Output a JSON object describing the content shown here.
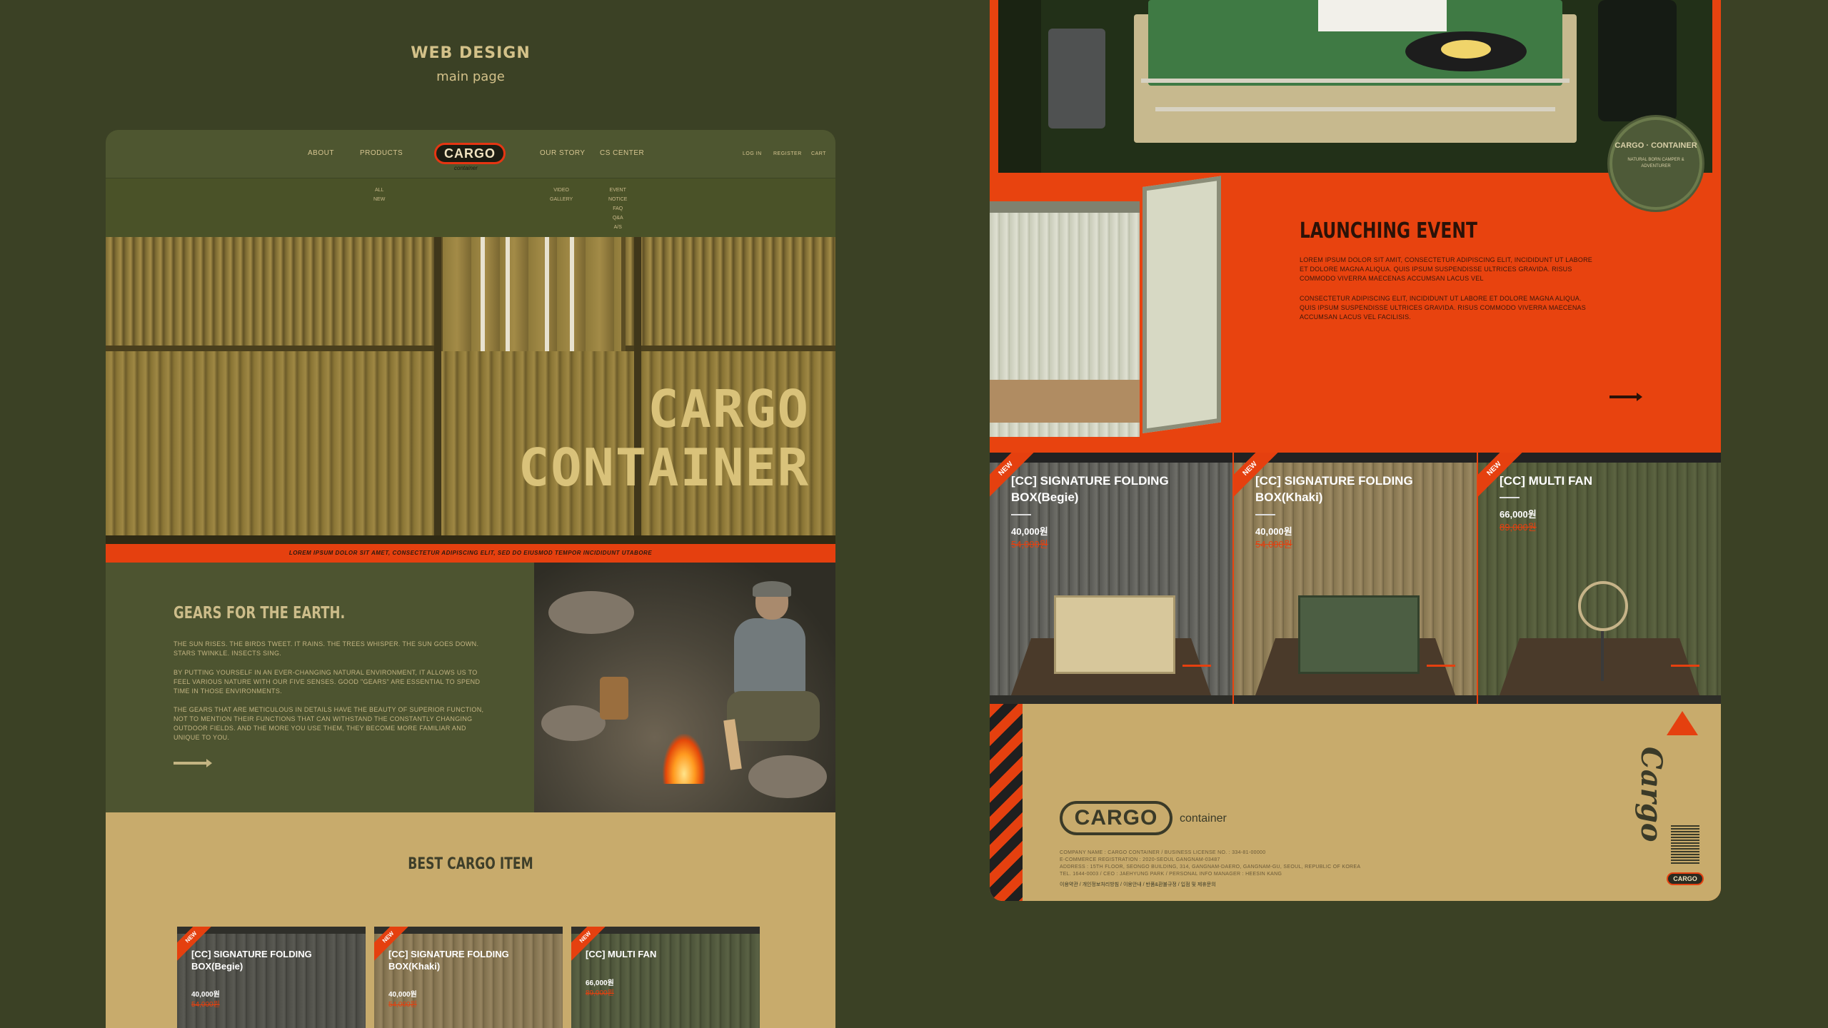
{
  "caption": {
    "title": "WEB DESIGN",
    "subtitle": "main page"
  },
  "nav": {
    "about": "ABOUT",
    "products": "PRODUCTS",
    "logo": "CARGO",
    "logo_sub": "container",
    "story": "OUR STORY",
    "cs": "CS CENTER",
    "login": "LOG IN",
    "register": "REGISTER",
    "cart": "CART",
    "sub_products": "ALL\nNEW",
    "sub_story": "VIDEO\nGALLERY",
    "sub_cs": "EVENT\nNOTICE\nFAQ\nQ&A\nA/S"
  },
  "hero": {
    "line1": "CARGO",
    "line2": "CONTAINER",
    "strip": "LOREM IPSUM DOLOR SIT AMET, CONSECTETUR ADIPISCING ELIT, SED DO EIUSMOD TEMPOR INCIDIDUNT UTABORE"
  },
  "gears": {
    "title": "GEARS FOR THE EARTH.",
    "p1": "THE SUN RISES. THE BIRDS TWEET. IT RAINS. THE TREES WHISPER. THE SUN GOES DOWN. STARS TWINKLE. INSECTS SING.",
    "p2": "BY PUTTING YOURSELF IN AN EVER-CHANGING NATURAL ENVIRONMENT, IT ALLOWS US TO FEEL VARIOUS NATURE WITH OUR FIVE SENSES. GOOD \"GEARS\" ARE ESSENTIAL TO SPEND TIME IN THOSE ENVIRONMENTS.",
    "p3": "THE GEARS THAT ARE METICULOUS IN DETAILS HAVE THE BEAUTY OF SUPERIOR FUNCTION, NOT TO MENTION THEIR FUNCTIONS THAT CAN WITHSTAND THE CONSTANTLY CHANGING OUTDOOR FIELDS. AND THE MORE YOU USE THEM, THEY BECOME MORE FAMILIAR AND UNIQUE TO YOU."
  },
  "best": {
    "title": "BEST CARGO ITEM",
    "prev": "‹",
    "next": "›",
    "items": [
      {
        "badge": "NEW",
        "name": "[CC] SIGNATURE FOLDING BOX(Begie)",
        "price": "40,000원",
        "old": "54,000원"
      },
      {
        "badge": "NEW",
        "name": "[CC] SIGNATURE FOLDING BOX(Khaki)",
        "price": "40,000원",
        "old": "54,000원"
      },
      {
        "badge": "NEW",
        "name": "[CC] MULTI FAN",
        "price": "66,000원",
        "old": "89,000원"
      }
    ]
  },
  "stamp": {
    "title": "CARGO · CONTAINER",
    "sub": "NATURAL BORN CAMPER & ADVENTURER"
  },
  "launch": {
    "title": "LAUNCHING EVENT",
    "p1": "LOREM IPSUM DOLOR SIT AMIT, CONSECTETUR ADIPISCING ELIT, INCIDIDUNT UT LABORE ET DOLORE MAGNA ALIQUA. QUIS IPSUM SUSPENDISSE ULTRICES GRAVIDA. RISUS COMMODO VIVERRA MAECENAS ACCUMSAN LACUS VEL",
    "p2": "CONSECTETUR ADIPISCING ELIT, INCIDIDUNT UT LABORE ET DOLORE MAGNA ALIQUA. QUIS IPSUM SUSPENDISSE ULTRICES GRAVIDA. RISUS COMMODO VIVERRA MAECENAS ACCUMSAN LACUS VEL FACILISIS."
  },
  "products": [
    {
      "badge": "NEW",
      "name": "[CC] SIGNATURE FOLDING BOX(Begie)",
      "price": "40,000원",
      "old": "54,000원"
    },
    {
      "badge": "NEW",
      "name": "[CC] SIGNATURE FOLDING BOX(Khaki)",
      "price": "40,000원",
      "old": "54,000원"
    },
    {
      "badge": "NEW",
      "name": "[CC] MULTI FAN",
      "price": "66,000원",
      "old": "89,000원"
    }
  ],
  "footer": {
    "logo": "CARGO",
    "logo_sub": "container",
    "line1": "COMPANY NAME : CARGO CONTAINER / BUSINESS LICENSE NO. : 334-81-00000",
    "line2": "E-COMMERCE REGISTRATION : 2020-SEOUL GANGNAM-03487",
    "line3": "ADDRESS : 15TH FLOOR, SEONGO BUILDING, 314, GANGNAM-DAERO, GANGNAM-GU, SEOUL, REPUBLIC OF KOREA",
    "line4": "TEL. 1644-0003 / CEO : JAEHYUNG PARK / PERSONAL INFO MANAGER : HEESIN KANG",
    "links": "이용약관 / 개인정보처리방침 / 이용안내 / 반품&환불규정 / 입점 및 제휴문의",
    "vertical": "Cargo",
    "mini": "CARGO"
  }
}
